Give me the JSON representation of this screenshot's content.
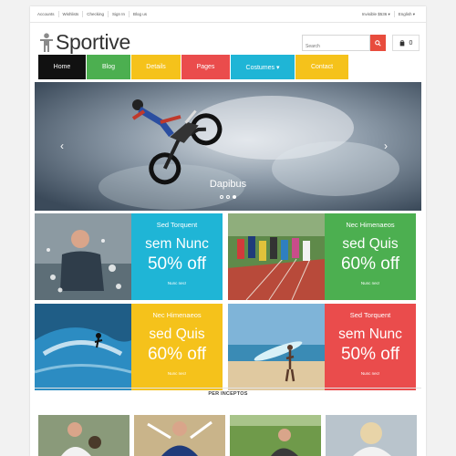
{
  "topbar": {
    "links": [
      "Accounts",
      "Wishlists",
      "Checking",
      "Sign In",
      "Blog us"
    ],
    "currency": "Invisible $536 ▾",
    "language": "English ▾"
  },
  "header": {
    "logo_text": "Sportive",
    "search_placeholder": "Search",
    "cart_count": "0"
  },
  "nav": {
    "items": [
      {
        "label": "Home",
        "color": "#111111"
      },
      {
        "label": "Blog",
        "color": "#4caf50"
      },
      {
        "label": "Details",
        "color": "#f5c21b"
      },
      {
        "label": "Pages",
        "color": "#ea4c4c"
      },
      {
        "label": "Costumes ▾",
        "color": "#1fb5d6"
      },
      {
        "label": "Contact",
        "color": "#f5c21b"
      }
    ]
  },
  "slider": {
    "caption": "Dapibus",
    "prev_arrow": "‹",
    "next_arrow": "›"
  },
  "banners": [
    {
      "kicker": "Sed Torquent",
      "headline": "sem Nunc",
      "offer": "50% off",
      "link": "Nunc nec!",
      "color": "#1fb5d6"
    },
    {
      "kicker": "Nec Himenaeos",
      "headline": "sed Quis",
      "offer": "60% off",
      "link": "Nunc nec!",
      "color": "#4caf50"
    },
    {
      "kicker": "Nec Himenaeos",
      "headline": "sed Quis",
      "offer": "60% off",
      "link": "Nunc nec!",
      "color": "#f5c21b"
    },
    {
      "kicker": "Sed Torquent",
      "headline": "sem Nunc",
      "offer": "50% off",
      "link": "Nunc nec!",
      "color": "#ea4c4c"
    }
  ],
  "section": {
    "title": "PER INCEPTOS"
  }
}
